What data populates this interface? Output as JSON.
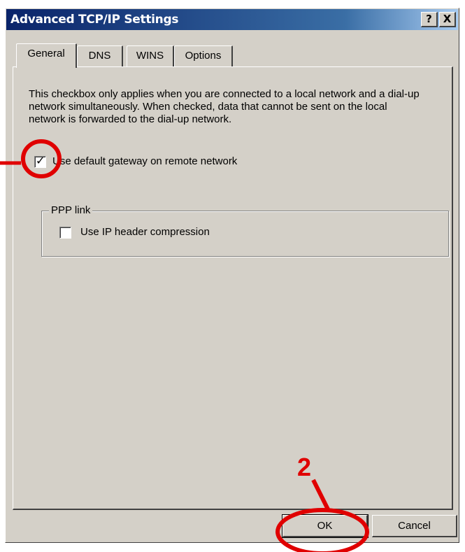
{
  "window": {
    "title": "Advanced TCP/IP Settings",
    "help_label": "?",
    "close_label": "X"
  },
  "tabs": [
    {
      "label": "General",
      "active": true
    },
    {
      "label": "DNS",
      "active": false
    },
    {
      "label": "WINS",
      "active": false
    },
    {
      "label": "Options",
      "active": false
    }
  ],
  "general": {
    "description": "This checkbox only applies when you are connected to a local network and a dial-up network simultaneously.  When checked, data that cannot be sent on the local network is forwarded to the dial-up network.",
    "default_gateway": {
      "label": "Use default gateway on remote network",
      "checked": true
    },
    "ppp_group": {
      "title": "PPP link",
      "ip_header_compression": {
        "label": "Use IP header compression",
        "checked": false
      }
    }
  },
  "buttons": {
    "ok": "OK",
    "cancel": "Cancel"
  },
  "annotations": {
    "step_label": "2",
    "color": "#e00000"
  }
}
